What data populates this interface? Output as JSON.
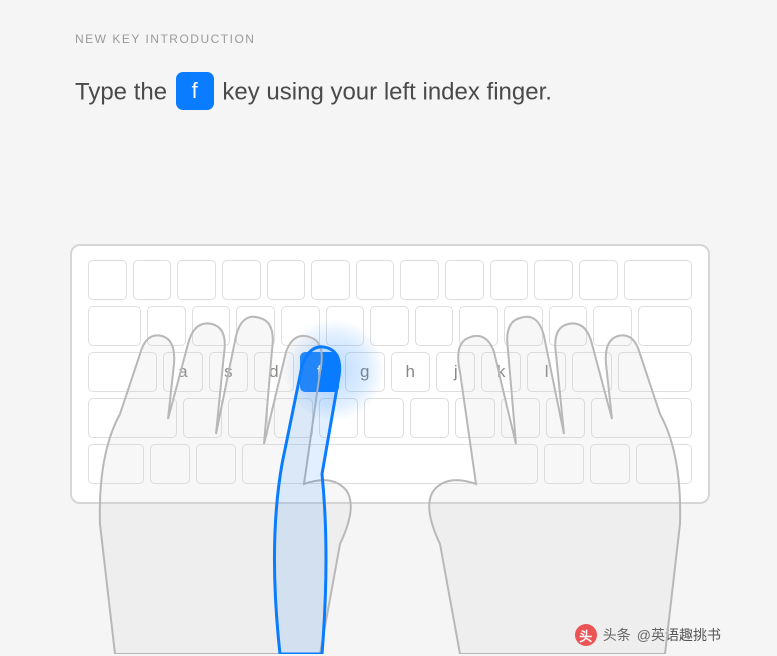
{
  "eyebrow": "NEW KEY INTRODUCTION",
  "instruction": {
    "before": "Type the ",
    "key": "f",
    "after": " key using your left index finger."
  },
  "highlighted_key": "f",
  "home_row_labels": [
    "a",
    "s",
    "d",
    "f",
    "g",
    "h",
    "j",
    "k",
    "l"
  ],
  "watermark": {
    "prefix": "头条",
    "account": "@英语趣挑书"
  }
}
